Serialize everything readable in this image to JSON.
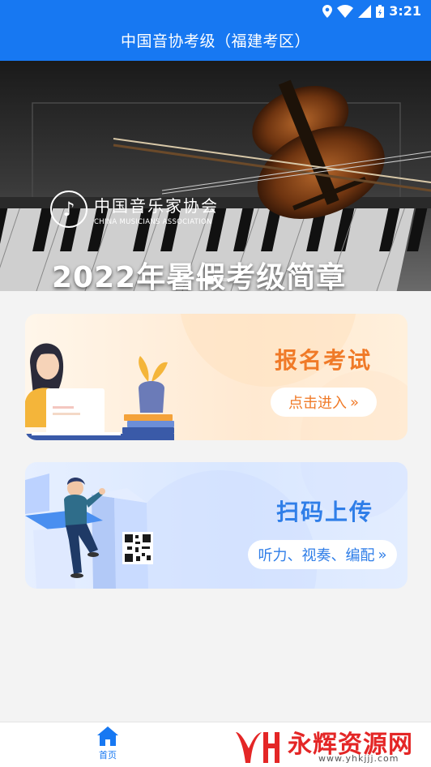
{
  "status_bar": {
    "time": "3:21"
  },
  "header": {
    "title": "中国音协考级（福建考区）"
  },
  "banner": {
    "logo_cn": "中国音乐家协会",
    "logo_en": "CHINA MUSICIANS ASSOCIATION",
    "title": "2022年暑假考级简章",
    "active_slide": 1,
    "slide_count": 2
  },
  "cards": {
    "exam": {
      "title": "报名考试",
      "button": "点击进入",
      "chevron": "»"
    },
    "scan": {
      "title": "扫码上传",
      "button": "听力、视奏、编配",
      "chevron": "»"
    }
  },
  "bottom_nav": {
    "home_label": "首页",
    "home_icon": "home-icon",
    "accent": "#1778f2"
  },
  "watermark": {
    "name": "永辉资源网",
    "url": "www.yhkjjj.com"
  },
  "colors": {
    "header": "#1778f2",
    "exam_accent": "#f07a28",
    "scan_accent": "#2f7ee8"
  }
}
